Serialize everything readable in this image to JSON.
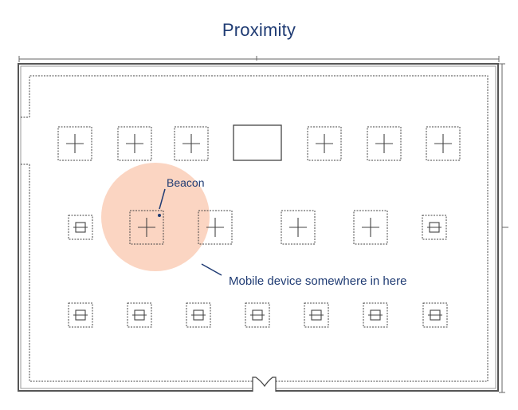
{
  "title": "Proximity",
  "colors": {
    "title": "#1f3b73",
    "annotation": "#1f3b73",
    "proximity_zone": "#fbd5c2",
    "walls": "#555555",
    "fixtures": "#444444"
  },
  "annotations": {
    "beacon_label": "Beacon",
    "mobile_label": "Mobile device somewhere in here"
  },
  "floor_plan": {
    "rows": [
      {
        "name": "top-row",
        "fixtures": [
          "cross",
          "cross",
          "cross",
          "solid-box",
          "cross",
          "cross",
          "cross"
        ]
      },
      {
        "name": "middle-row",
        "fixtures": [
          "small",
          "cross",
          "cross",
          "cross",
          "cross",
          "small"
        ]
      },
      {
        "name": "bottom-row",
        "fixtures": [
          "small",
          "small",
          "small",
          "small",
          "small",
          "small",
          "small"
        ]
      }
    ],
    "door": "double-door-bottom"
  }
}
